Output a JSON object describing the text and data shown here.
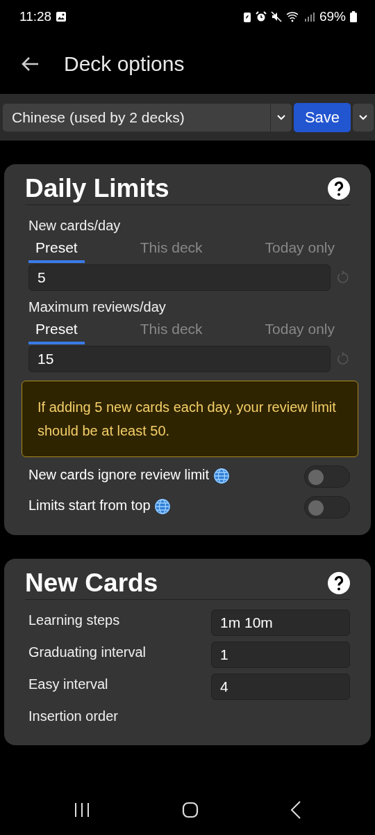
{
  "status_bar": {
    "time": "11:28",
    "battery": "69%"
  },
  "app_bar": {
    "title": "Deck options"
  },
  "preset_bar": {
    "preset": "Chinese (used by 2 decks)",
    "save": "Save"
  },
  "daily_limits": {
    "title": "Daily Limits",
    "limits": [
      {
        "label": "New cards/day",
        "tabs": [
          {
            "label": "Preset",
            "selected": true
          },
          {
            "label": "This deck",
            "selected": false
          },
          {
            "label": "Today only",
            "selected": false
          }
        ],
        "value": "5"
      },
      {
        "label": "Maximum reviews/day",
        "tabs": [
          {
            "label": "Preset",
            "selected": true
          },
          {
            "label": "This deck",
            "selected": false
          },
          {
            "label": "Today only",
            "selected": false
          }
        ],
        "value": "15"
      }
    ],
    "warning": "If adding 5 new cards each day, your review limit should be at least 50.",
    "toggles": [
      {
        "label": "New cards ignore review limit",
        "on": false
      },
      {
        "label": "Limits start from top",
        "on": false
      }
    ]
  },
  "new_cards": {
    "title": "New Cards",
    "fields": [
      {
        "label": "Learning steps",
        "value": "1m 10m"
      },
      {
        "label": "Graduating interval",
        "value": "1"
      },
      {
        "label": "Easy interval",
        "value": "4"
      }
    ],
    "next_label": "Insertion order"
  }
}
